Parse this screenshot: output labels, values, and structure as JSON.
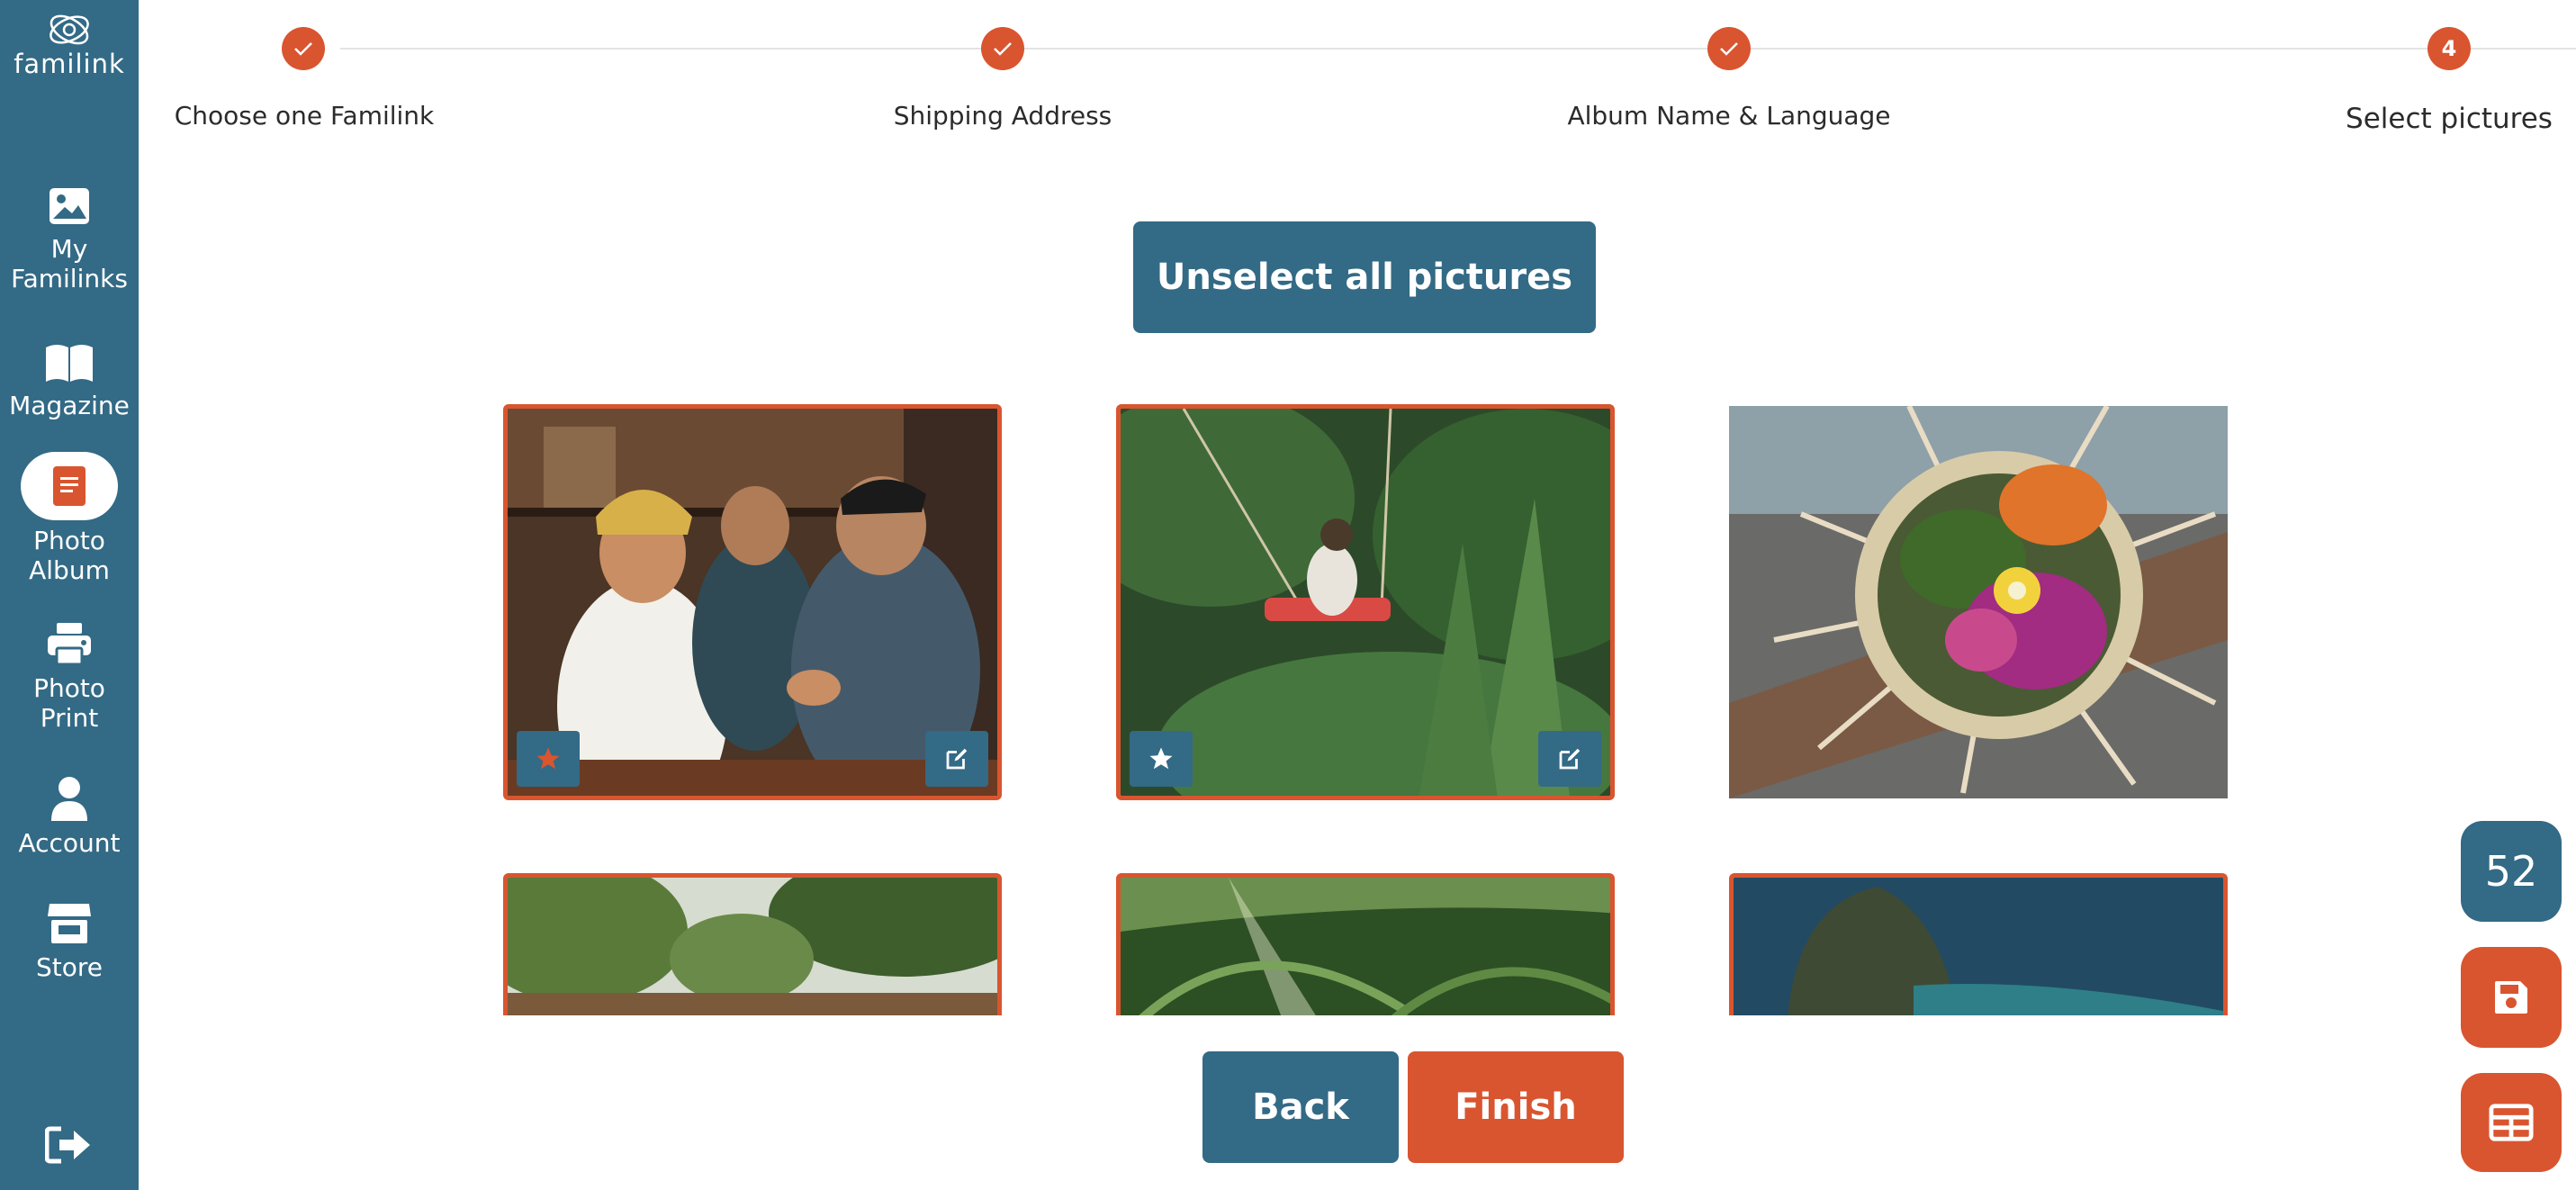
{
  "app": {
    "logo_text": "familink"
  },
  "sidebar": {
    "items": [
      {
        "label_line1": "My",
        "label_line2": "Familinks",
        "icon": "image-icon"
      },
      {
        "label_line1": "Magazine",
        "label_line2": "",
        "icon": "book-open-icon"
      },
      {
        "label_line1": "Photo",
        "label_line2": "Album",
        "icon": "photo-album-icon",
        "active": true
      },
      {
        "label_line1": "Photo",
        "label_line2": "Print",
        "icon": "printer-icon"
      },
      {
        "label_line1": "Account",
        "label_line2": "",
        "icon": "user-icon"
      },
      {
        "label_line1": "Store",
        "label_line2": "",
        "icon": "store-icon"
      }
    ],
    "logout_icon": "logout-icon"
  },
  "stepper": {
    "steps": [
      {
        "label": "Choose one Familink",
        "state": "done"
      },
      {
        "label": "Shipping Address",
        "state": "done"
      },
      {
        "label": "Album Name & Language",
        "state": "done"
      },
      {
        "label": "Select pictures",
        "state": "current",
        "number": "4"
      }
    ]
  },
  "actions": {
    "unselect_all": "Unselect all pictures",
    "back": "Back",
    "finish": "Finish"
  },
  "photos": [
    {
      "subject": "ceremony",
      "selected": true,
      "favorite": true
    },
    {
      "subject": "swing",
      "selected": true,
      "favorite": false
    },
    {
      "subject": "offering",
      "selected": false,
      "favorite": false
    },
    {
      "subject": "garden-sign",
      "selected": true
    },
    {
      "subject": "palm-forest",
      "selected": true
    },
    {
      "subject": "sea-cliff",
      "selected": true
    }
  ],
  "floating": {
    "selected_count": "52",
    "save_icon": "save-icon",
    "layout_icon": "layout-grid-icon"
  },
  "colors": {
    "primary": "#336a86",
    "accent": "#d9552f"
  }
}
